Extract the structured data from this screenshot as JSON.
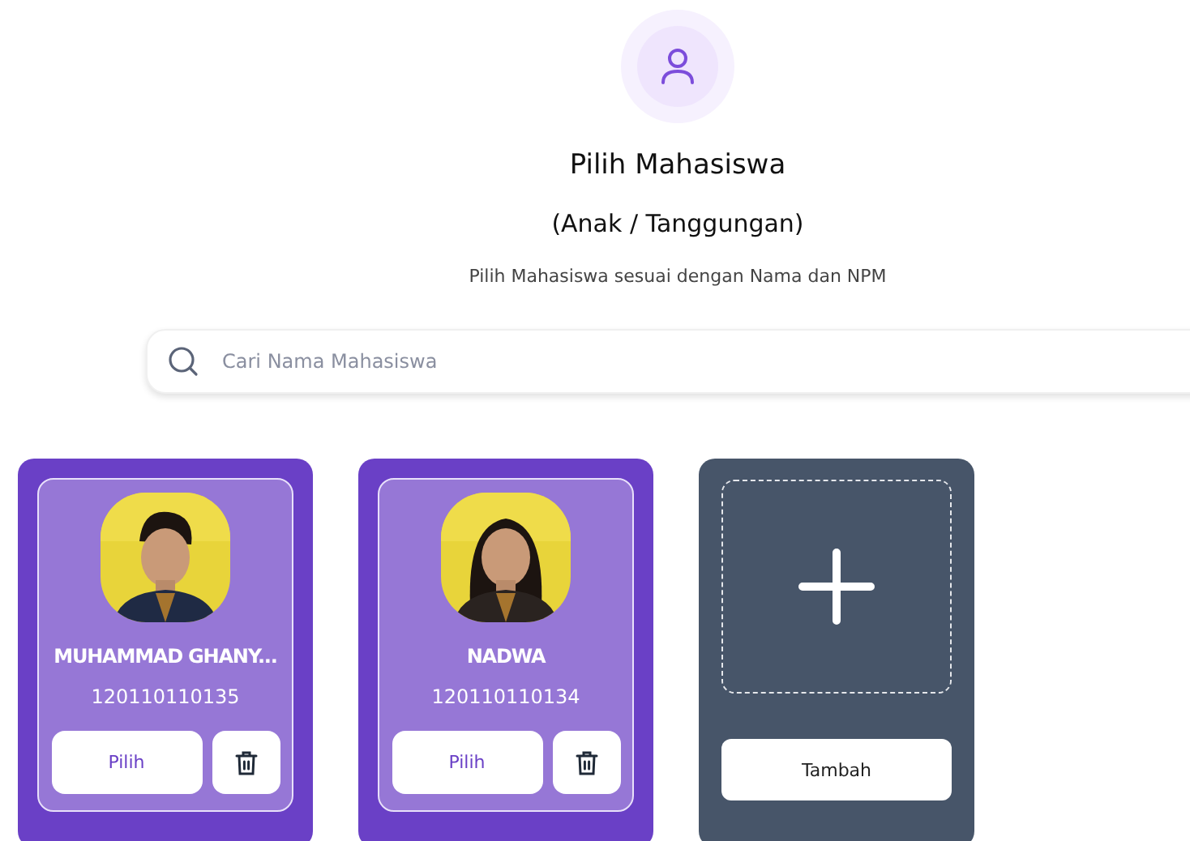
{
  "header": {
    "title": "Pilih Mahasiswa",
    "subtitle": "(Anak / Tanggungan)",
    "description": "Pilih Mahasiswa sesuai dengan Nama dan NPM"
  },
  "search": {
    "placeholder": "Cari Nama Mahasiswa"
  },
  "students": [
    {
      "name": "MUHAMMAD GHANY...",
      "npm": "120110110135",
      "select_label": "Pilih"
    },
    {
      "name": "NADWA",
      "npm": "120110110134",
      "select_label": "Pilih"
    }
  ],
  "add_card": {
    "label": "Tambah"
  }
}
